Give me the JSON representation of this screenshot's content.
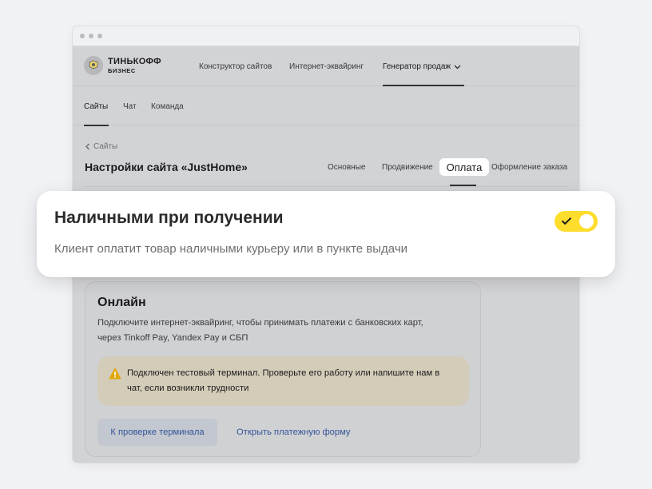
{
  "brand": {
    "name_line1": "ТИНЬКОФФ",
    "name_line2": "БИЗНЕС"
  },
  "topnav": {
    "items": [
      {
        "label": "Конструктор сайтов"
      },
      {
        "label": "Интернет-эквайринг"
      },
      {
        "label": "Генератор продаж",
        "active": true,
        "has_dropdown": true
      }
    ]
  },
  "subnav": {
    "items": [
      {
        "label": "Сайты",
        "active": true
      },
      {
        "label": "Чат"
      },
      {
        "label": "Команда"
      }
    ]
  },
  "breadcrumb": {
    "label": "Сайты"
  },
  "page": {
    "title": "Настройки сайта «JustHome»"
  },
  "tabs": [
    {
      "label": "Основные"
    },
    {
      "label": "Продвижение"
    },
    {
      "label": "Оплата",
      "active": true
    },
    {
      "label": "Оформление заказа"
    }
  ],
  "cash_option": {
    "title": "Наличными при получении",
    "description": "Клиент оплатит товар наличными курьеру или в пункте выдачи",
    "enabled": true
  },
  "online": {
    "title": "Онлайн",
    "description": "Подключите интернет-эквайринг, чтобы принимать платежи с банковских карт, через Tinkoff Pay, Yandex Pay и СБП",
    "notice": "Подключен тестовый терминал. Проверьте его работу или напишите нам в чат, если возникли трудности",
    "button_check": "К проверке терминала",
    "link_open_form": "Открыть платежную форму"
  },
  "colors": {
    "accent_yellow": "#ffdd2d",
    "link_blue": "#33549a",
    "warning": "#e2a70a"
  },
  "icons": [
    "tinkoff-logo-icon",
    "chevron-down-icon",
    "chevron-left-icon",
    "warning-icon",
    "check-icon"
  ]
}
